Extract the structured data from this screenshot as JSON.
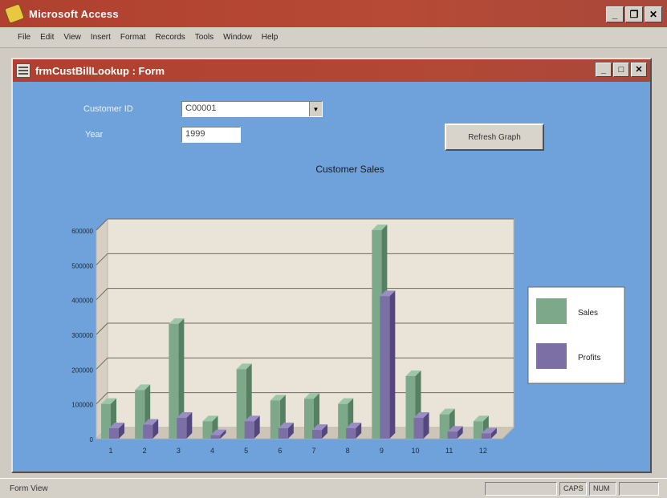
{
  "app": {
    "title": "Microsoft Access"
  },
  "menu": {
    "items": [
      "File",
      "Edit",
      "View",
      "Insert",
      "Format",
      "Records",
      "Tools",
      "Window",
      "Help"
    ]
  },
  "form": {
    "title": "frmCustBillLookup : Form",
    "customer_label": "Customer ID",
    "customer_value": "C00001",
    "year_label": "Year",
    "year_value": "1999",
    "refresh_button": "Refresh Graph",
    "chart_title": "Customer Sales"
  },
  "status": {
    "text": "Form View",
    "caps": "CAPS",
    "num": "NUM"
  },
  "chart_data": {
    "type": "bar",
    "title": "Customer Sales",
    "categories": [
      "1",
      "2",
      "3",
      "4",
      "5",
      "6",
      "7",
      "8",
      "9",
      "10",
      "11",
      "12"
    ],
    "series": [
      {
        "name": "Sales",
        "color": "#7ea88a",
        "values": [
          100000,
          140000,
          330000,
          50000,
          200000,
          110000,
          115000,
          100000,
          600000,
          180000,
          70000,
          50000
        ]
      },
      {
        "name": "Profits",
        "color": "#7b6fa6",
        "values": [
          30000,
          40000,
          60000,
          10000,
          50000,
          30000,
          25000,
          30000,
          410000,
          60000,
          20000,
          15000
        ]
      }
    ],
    "ylim": [
      0,
      600000
    ],
    "yticks": [
      "0",
      "100000",
      "200000",
      "300000",
      "400000",
      "500000",
      "600000"
    ],
    "legend_position": "right",
    "grid": true
  },
  "colors": {
    "titlebar": "#b0402f",
    "form_background": "#6fa2da",
    "plot_wall": "#e9e3d8"
  },
  "icons": {
    "app": "access-key-icon",
    "form": "form-icon"
  }
}
